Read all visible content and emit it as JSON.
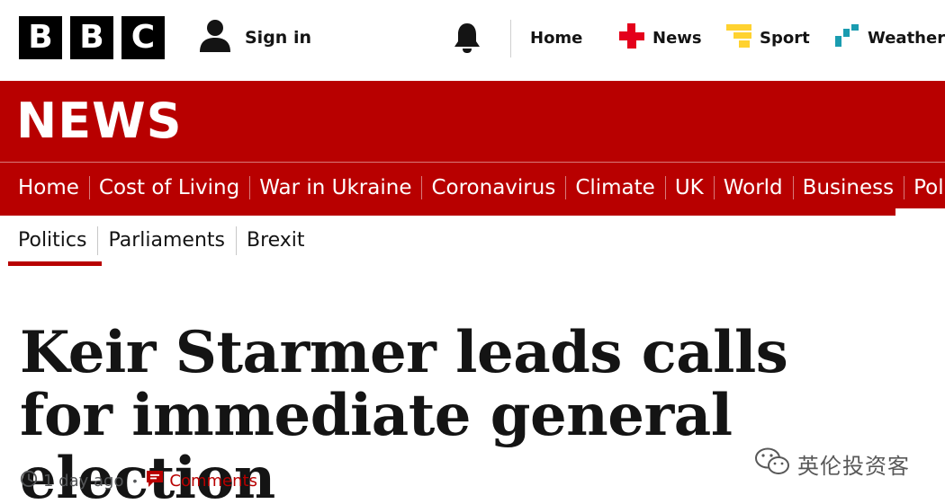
{
  "header": {
    "logo_letters": [
      "B",
      "B",
      "C"
    ],
    "sign_in": "Sign in",
    "icons": {
      "user": "user-icon",
      "notifications": "bell-icon",
      "news": "news-icon",
      "sport": "sport-icon",
      "weather": "weather-icon"
    },
    "nav": [
      {
        "label": "Home",
        "icon": null
      },
      {
        "label": "News",
        "icon": "news-icon"
      },
      {
        "label": "Sport",
        "icon": "sport-icon"
      },
      {
        "label": "Weather",
        "icon": "weather-icon"
      }
    ]
  },
  "brand": {
    "wordmark": "NEWS",
    "band_color": "#b80000"
  },
  "section_nav": [
    "Home",
    "Cost of Living",
    "War in Ukraine",
    "Coronavirus",
    "Climate",
    "UK",
    "World",
    "Business",
    "Poli"
  ],
  "sub_nav": {
    "items": [
      "Politics",
      "Parliaments",
      "Brexit"
    ],
    "active": "Politics"
  },
  "article": {
    "headline": "Keir Starmer leads calls for immediate general election",
    "published": "1 day ago",
    "comments": "Comments"
  },
  "watermark": {
    "text": "英伦投资客"
  }
}
